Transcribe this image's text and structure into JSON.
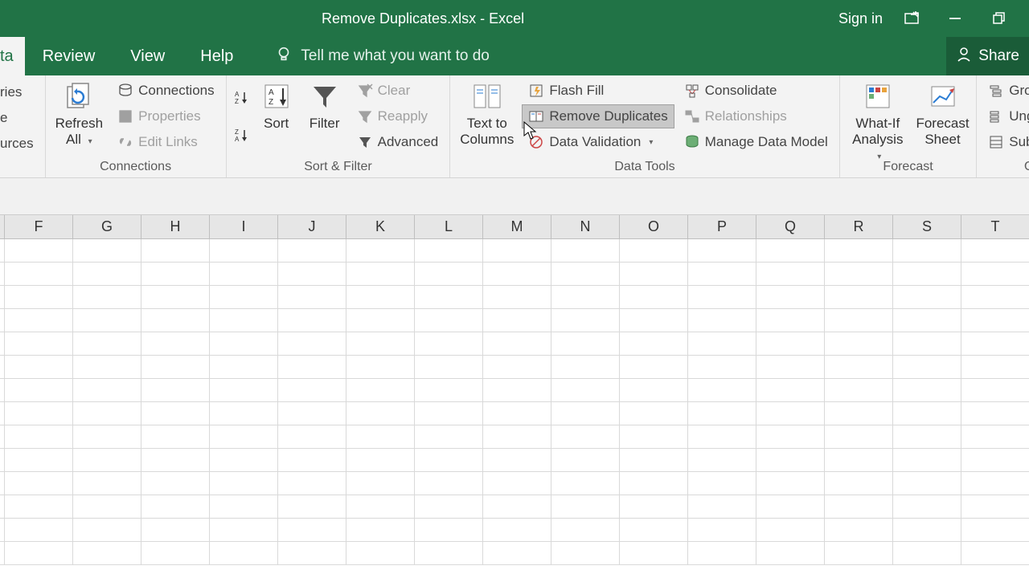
{
  "title": {
    "filename": "Remove Duplicates.xlsx",
    "sep": "  -  ",
    "app": "Excel"
  },
  "titlebar": {
    "sign_in": "Sign in"
  },
  "tabs": {
    "data": "ta",
    "review": "Review",
    "view": "View",
    "help": "Help",
    "tellme": "Tell me what you want to do",
    "share": "Share"
  },
  "ribbon": {
    "get_transform": {
      "queries": "ries",
      "table": "e",
      "sources": "urces"
    },
    "connections": {
      "refresh": "Refresh All",
      "connections": "Connections",
      "properties": "Properties",
      "edit_links": "Edit Links",
      "group": "Connections"
    },
    "sort_filter": {
      "sort": "Sort",
      "filter": "Filter",
      "clear": "Clear",
      "reapply": "Reapply",
      "advanced": "Advanced",
      "group": "Sort & Filter"
    },
    "data_tools": {
      "text_to_columns": "Text to Columns",
      "flash_fill": "Flash Fill",
      "remove_duplicates": "Remove Duplicates",
      "data_validation": "Data Validation",
      "consolidate": "Consolidate",
      "relationships": "Relationships",
      "manage_data_model": "Manage Data Model",
      "group": "Data Tools"
    },
    "forecast": {
      "whatif": "What-If Analysis",
      "forecast_sheet": "Forecast Sheet",
      "group": "Forecast"
    },
    "outline": {
      "group_btn": "Group",
      "ungroup": "Ungroup",
      "subtotal": "Subtotal",
      "group": "Outline"
    }
  },
  "columns": [
    "F",
    "G",
    "H",
    "I",
    "J",
    "K",
    "L",
    "M",
    "N",
    "O",
    "P",
    "Q",
    "R",
    "S",
    "T"
  ],
  "row_count": 14
}
